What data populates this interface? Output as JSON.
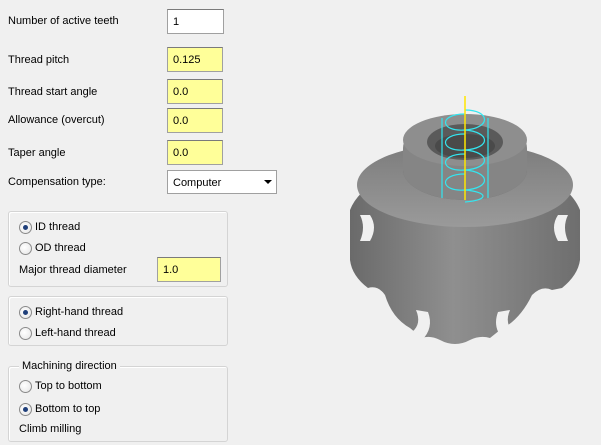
{
  "fields": {
    "active_teeth": {
      "label": "Number of active teeth",
      "value": "1"
    },
    "thread_pitch": {
      "label": "Thread pitch",
      "value": "0.125"
    },
    "thread_start_angle": {
      "label": "Thread start angle",
      "value": "0.0"
    },
    "allowance": {
      "label": "Allowance (overcut)",
      "value": "0.0"
    },
    "taper_angle": {
      "label": "Taper angle",
      "value": "0.0"
    },
    "compensation": {
      "label": "Compensation type:",
      "value": "Computer"
    }
  },
  "thread_type": {
    "options": [
      "ID thread",
      "OD thread"
    ],
    "selected": "ID thread",
    "major_diameter_label": "Major thread diameter",
    "major_diameter_value": "1.0"
  },
  "hand": {
    "options": [
      "Right-hand thread",
      "Left-hand thread"
    ],
    "selected": "Right-hand thread"
  },
  "machining_direction": {
    "title": "Machining direction",
    "options": [
      "Top to bottom",
      "Bottom to top"
    ],
    "selected": "Bottom to top",
    "milling_label": "Climb milling"
  },
  "colors": {
    "input_highlight": "#ffff99",
    "toolpath": "#33e6f0",
    "axis": "#ffe600",
    "part": "#7a7a7a"
  },
  "icons": [
    "radio-button-icon",
    "dropdown-arrow-icon"
  ]
}
